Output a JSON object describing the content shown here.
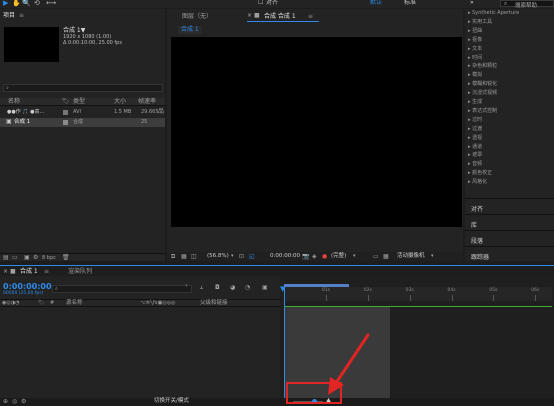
{
  "toolbar": {
    "tools": [
      "▶",
      "✋",
      "🔍",
      "⟲",
      "⟷"
    ],
    "align_label": "对齐",
    "workspace_default": "默认",
    "workspace_standard": "标准",
    "search_placeholder": "搜索帮助"
  },
  "project": {
    "title": "项目",
    "comp_name": "合成 1▼",
    "comp_resolution": "1920 x 1080 (1.00)",
    "comp_duration": "Δ 0:00:10:00, 25.00 fps",
    "columns": {
      "name": "名称",
      "type": "类型",
      "size": "大小",
      "rate": "帧速率"
    },
    "rows": [
      {
        "name": "●●作 🎵 ●高…",
        "type": "AVI",
        "size": "1.5 MB",
        "rate": "29.665"
      },
      {
        "name": "合成 1",
        "type": "合成",
        "size": "",
        "rate": "25"
      }
    ],
    "footer_bpc": "8 bpc"
  },
  "viewer": {
    "footage_tab": "图层（无）",
    "comp_tab": "合成 合成 1",
    "comp_chip": "合成 1",
    "zoom": "(56.8%)",
    "timecode": "0:00:00:00",
    "quality": "(完整)",
    "camera": "活动摄像机"
  },
  "effects": {
    "items": [
      "▸ Synthetic Aperture",
      "▸ 实用工具",
      "▸ 扭曲",
      "▸ 抠像",
      "▸ 文本",
      "▸ 时间",
      "▸ 杂色和颗粒",
      "▸ 模拟",
      "▸ 模糊和锐化",
      "▸ 沉浸式视频",
      "▸ 生成",
      "▸ 表达式控制",
      "▸ 过时",
      "▸ 过渡",
      "▸ 透视",
      "▸ 通道",
      "▸ 遮罩",
      "▸ 音频",
      "▸ 颜色校正",
      "▸ 风格化"
    ],
    "sections": [
      "对齐",
      "库",
      "段落",
      "跟踪器"
    ]
  },
  "timeline": {
    "tab_comp": "合成 1",
    "tab_render": "渲染队列",
    "timecode": "0:00:00:00",
    "timecode_sub": "00000 (25.00 fps)",
    "col_source": "源名称",
    "col_parent": "父级和链接",
    "ruler_ticks": [
      "0s",
      "01s",
      "02s",
      "03s",
      "04s",
      "05s",
      "06s"
    ],
    "toggle_label": "切换开关/模式"
  }
}
